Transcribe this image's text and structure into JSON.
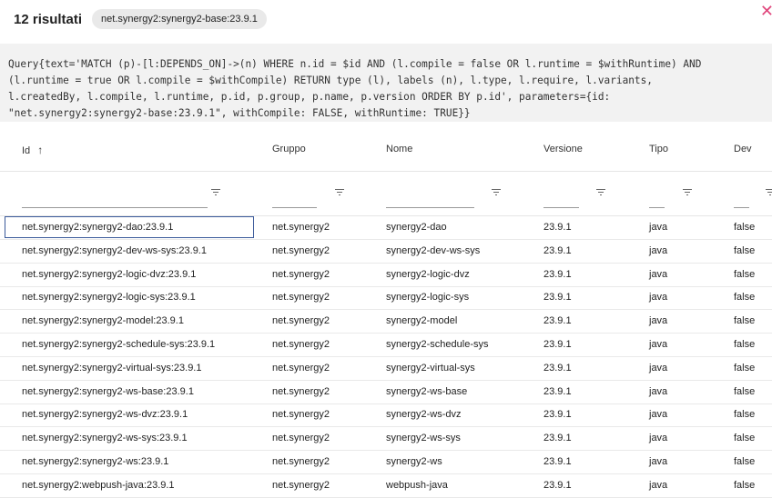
{
  "header": {
    "title": "12 risultati",
    "chip": "net.synergy2:synergy2-base:23.9.1"
  },
  "query": "Query{text='MATCH (p)-[l:DEPENDS_ON]->(n) WHERE n.id = $id AND (l.compile = false OR l.runtime = $withRuntime) AND\n(l.runtime = true OR l.compile = $withCompile) RETURN type (l), labels (n), l.type, l.require, l.variants,\nl.createdBy, l.compile, l.runtime, p.id, p.group, p.name, p.version ORDER BY p.id', parameters={id:\n\"net.synergy2:synergy2-base:23.9.1\", withCompile: FALSE, withRuntime: TRUE}}",
  "columns": [
    "Id",
    "Gruppo",
    "Nome",
    "Versione",
    "Tipo",
    "Dev"
  ],
  "sort_icon": "arrow-up-icon",
  "filter_icon": "filter-icon",
  "close_icon": "close-icon",
  "rows": [
    [
      "net.synergy2:synergy2-dao:23.9.1",
      "net.synergy2",
      "synergy2-dao",
      "23.9.1",
      "java",
      "false"
    ],
    [
      "net.synergy2:synergy2-dev-ws-sys:23.9.1",
      "net.synergy2",
      "synergy2-dev-ws-sys",
      "23.9.1",
      "java",
      "false"
    ],
    [
      "net.synergy2:synergy2-logic-dvz:23.9.1",
      "net.synergy2",
      "synergy2-logic-dvz",
      "23.9.1",
      "java",
      "false"
    ],
    [
      "net.synergy2:synergy2-logic-sys:23.9.1",
      "net.synergy2",
      "synergy2-logic-sys",
      "23.9.1",
      "java",
      "false"
    ],
    [
      "net.synergy2:synergy2-model:23.9.1",
      "net.synergy2",
      "synergy2-model",
      "23.9.1",
      "java",
      "false"
    ],
    [
      "net.synergy2:synergy2-schedule-sys:23.9.1",
      "net.synergy2",
      "synergy2-schedule-sys",
      "23.9.1",
      "java",
      "false"
    ],
    [
      "net.synergy2:synergy2-virtual-sys:23.9.1",
      "net.synergy2",
      "synergy2-virtual-sys",
      "23.9.1",
      "java",
      "false"
    ],
    [
      "net.synergy2:synergy2-ws-base:23.9.1",
      "net.synergy2",
      "synergy2-ws-base",
      "23.9.1",
      "java",
      "false"
    ],
    [
      "net.synergy2:synergy2-ws-dvz:23.9.1",
      "net.synergy2",
      "synergy2-ws-dvz",
      "23.9.1",
      "java",
      "false"
    ],
    [
      "net.synergy2:synergy2-ws-sys:23.9.1",
      "net.synergy2",
      "synergy2-ws-sys",
      "23.9.1",
      "java",
      "false"
    ],
    [
      "net.synergy2:synergy2-ws:23.9.1",
      "net.synergy2",
      "synergy2-ws",
      "23.9.1",
      "java",
      "false"
    ],
    [
      "net.synergy2:webpush-java:23.9.1",
      "net.synergy2",
      "webpush-java",
      "23.9.1",
      "java",
      "false"
    ]
  ]
}
